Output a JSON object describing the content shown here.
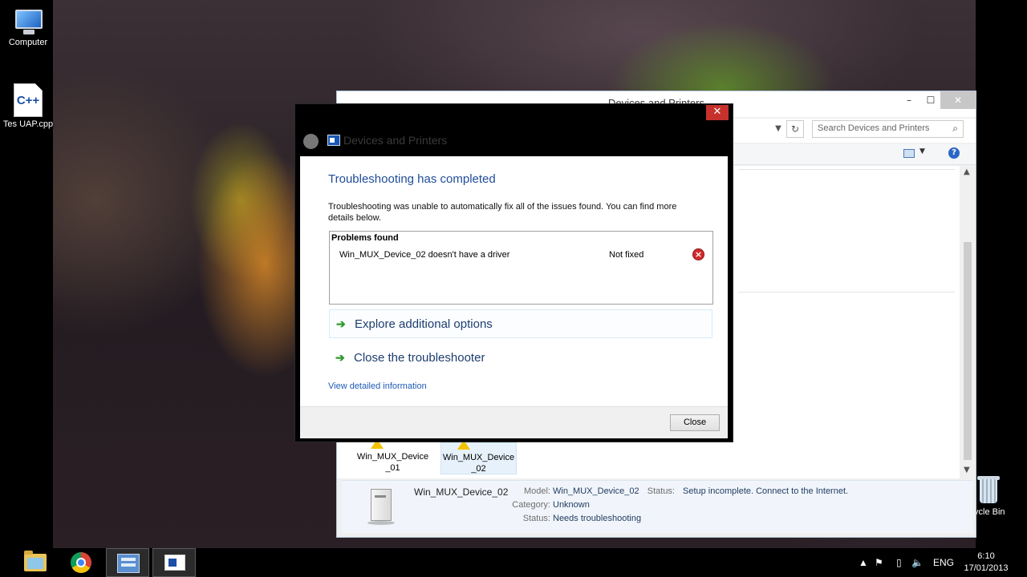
{
  "desktop": {
    "icons": [
      {
        "label": "Computer",
        "icon": "computer-icon"
      },
      {
        "label": "Tes UAP.cpp",
        "icon": "cpp-file-icon",
        "glyph_text": "C++"
      },
      {
        "label": "ycle Bin",
        "icon": "recycle-bin-icon"
      }
    ]
  },
  "explorer": {
    "title": "Devices and Printers",
    "search_placeholder": "Search Devices and Printers",
    "devices": [
      {
        "label": "Win_MUX_Device _01"
      },
      {
        "label": "Win_MUX_Device _02"
      }
    ],
    "details": {
      "name": "Win_MUX_Device_02",
      "model_label": "Model:",
      "model_value": "Win_MUX_Device_02",
      "category_label": "Category:",
      "category_value": "Unknown",
      "status_label": "Status:",
      "status_value": "Needs troubleshooting",
      "status2_label": "Status:",
      "status2_value": "Setup incomplete. Connect to the Internet."
    }
  },
  "dialog": {
    "caption": "Devices and Printers",
    "heading": "Troubleshooting has completed",
    "description": "Troubleshooting was unable to automatically fix all of the issues found. You can find more details below.",
    "problems_header": "Problems found",
    "problems": [
      {
        "name": "Win_MUX_Device_02 doesn't have a driver",
        "status": "Not fixed"
      }
    ],
    "options": [
      {
        "label": "Explore additional options"
      },
      {
        "label": "Close the troubleshooter"
      }
    ],
    "detail_link": "View detailed information",
    "close_button": "Close",
    "close_glyph": "✕"
  },
  "taskbar": {
    "apps": [
      {
        "name": "File Explorer",
        "icon": "file-explorer-icon"
      },
      {
        "name": "Google Chrome",
        "icon": "chrome-icon"
      },
      {
        "name": "Control Panel",
        "icon": "control-panel-icon"
      },
      {
        "name": "Devices and Printers",
        "icon": "devices-printers-icon"
      }
    ],
    "language": "ENG",
    "time": "6:10",
    "date": "17/01/2013"
  }
}
